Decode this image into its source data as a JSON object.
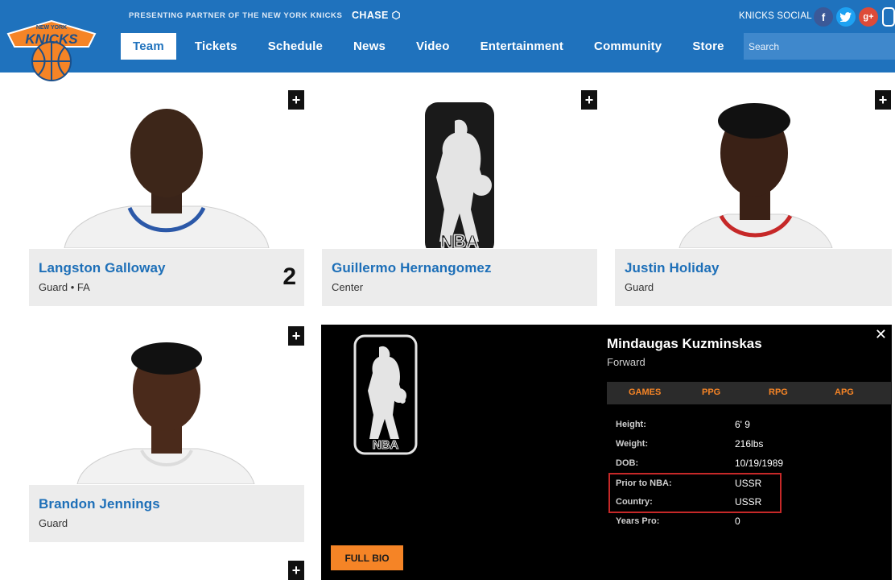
{
  "header": {
    "partner_text": "PRESENTING PARTNER OF THE NEW YORK KNICKS",
    "partner_brand": "CHASE",
    "logo_top_text": "NEW YORK",
    "logo_text": "KNICKS",
    "social_label": "KNICKS SOCIAL",
    "social": [
      {
        "icon": "facebook-icon",
        "glyph": "f",
        "color": "#3b5998"
      },
      {
        "icon": "twitter-icon",
        "glyph": "t",
        "color": "#1da1f2"
      },
      {
        "icon": "google-plus-icon",
        "glyph": "g+",
        "color": "#dd4b39"
      }
    ],
    "search_placeholder": "Search",
    "colors": {
      "header": "#1f72bd",
      "accent": "#f58426"
    }
  },
  "nav": [
    {
      "label": "Team",
      "active": true
    },
    {
      "label": "Tickets"
    },
    {
      "label": "Schedule"
    },
    {
      "label": "News"
    },
    {
      "label": "Video"
    },
    {
      "label": "Entertainment"
    },
    {
      "label": "Community"
    },
    {
      "label": "Store"
    }
  ],
  "players": [
    {
      "name": "Langston Galloway",
      "position": "Guard • FA",
      "number": "2",
      "photo": "player-photo"
    },
    {
      "name": "Guillermo Hernangomez",
      "position": "Center",
      "number": "",
      "photo": "nba-logo"
    },
    {
      "name": "Justin Holiday",
      "position": "Guard",
      "number": "",
      "photo": "player-photo"
    },
    {
      "name": "Brandon Jennings",
      "position": "Guard",
      "number": "",
      "photo": "player-photo"
    }
  ],
  "nba_logo_text": "NBA",
  "expanded": {
    "name": "Mindaugas Kuzminskas",
    "position": "Forward",
    "stats_headers": [
      "GAMES",
      "PPG",
      "RPG",
      "APG"
    ],
    "details": [
      {
        "label": "Height:",
        "value": "6' 9"
      },
      {
        "label": "Weight:",
        "value": "216lbs"
      },
      {
        "label": "DOB:",
        "value": "10/19/1989"
      },
      {
        "label": "Prior to NBA:",
        "value": "USSR"
      },
      {
        "label": "Country:",
        "value": "USSR"
      },
      {
        "label": "Years Pro:",
        "value": "0"
      }
    ],
    "button_label": "FULL BIO",
    "close_glyph": "✕"
  }
}
